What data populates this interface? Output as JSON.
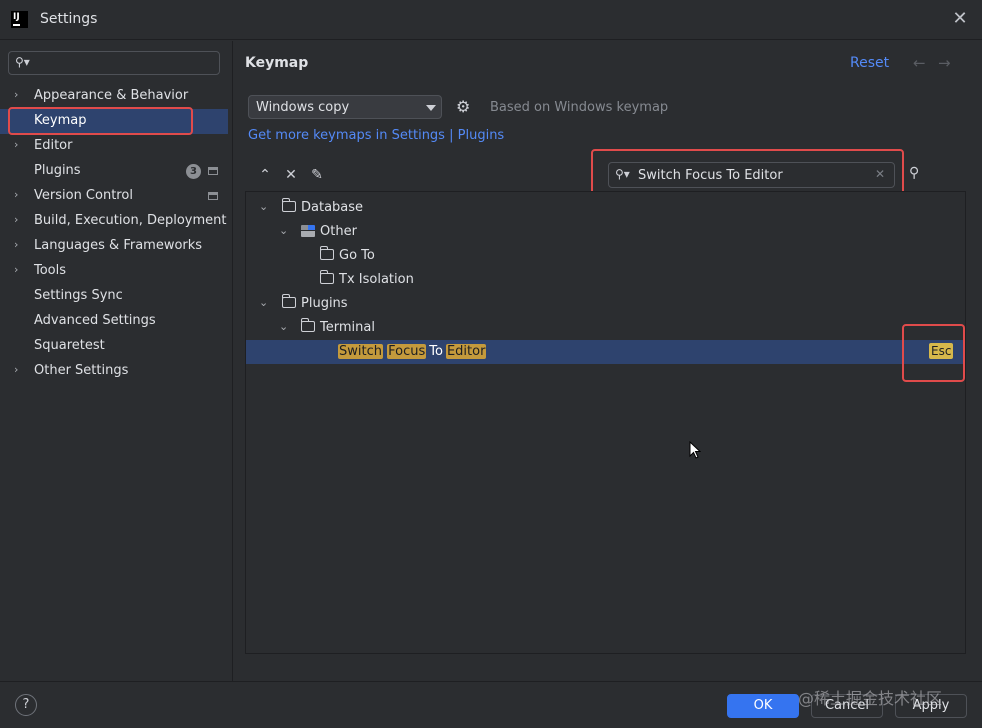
{
  "window": {
    "title": "Settings",
    "app_icon_text": "IJ"
  },
  "sidebar": {
    "search_placeholder": "",
    "items": [
      {
        "label": "Appearance & Behavior",
        "expandable": true
      },
      {
        "label": "Keymap",
        "expandable": false,
        "selected": true
      },
      {
        "label": "Editor",
        "expandable": true
      },
      {
        "label": "Plugins",
        "expandable": false,
        "badge": "3"
      },
      {
        "label": "Version Control",
        "expandable": true
      },
      {
        "label": "Build, Execution, Deployment",
        "expandable": true
      },
      {
        "label": "Languages & Frameworks",
        "expandable": true
      },
      {
        "label": "Tools",
        "expandable": true
      },
      {
        "label": "Settings Sync",
        "expandable": false
      },
      {
        "label": "Advanced Settings",
        "expandable": false
      },
      {
        "label": "Squaretest",
        "expandable": false
      },
      {
        "label": "Other Settings",
        "expandable": true
      }
    ]
  },
  "main": {
    "title": "Keymap",
    "reset_label": "Reset",
    "back_arrow": "←",
    "forward_arrow": "→",
    "keymap_select": "Windows copy",
    "based_on": "Based on Windows keymap",
    "more_keymaps_prefix": "Get more keymaps in Settings",
    "more_keymaps_sep": "|",
    "more_keymaps_link": "Plugins",
    "search_value": "Switch Focus To Editor",
    "tree": [
      {
        "label": "Database",
        "level": 0,
        "icon": "folder",
        "expanded": true
      },
      {
        "label": "Other",
        "level": 1,
        "icon": "other",
        "expanded": true
      },
      {
        "label": "Go To",
        "level": 2,
        "icon": "folder",
        "expanded": false
      },
      {
        "label": "Tx Isolation",
        "level": 2,
        "icon": "folder",
        "expanded": false
      },
      {
        "label": "Plugins",
        "level": 0,
        "icon": "folder",
        "expanded": true
      },
      {
        "label": "Terminal",
        "level": 1,
        "icon": "folder",
        "expanded": true
      }
    ],
    "action": {
      "words": [
        "Switch",
        "Focus",
        "To",
        "Editor"
      ],
      "shortcut": "Esc"
    }
  },
  "footer": {
    "help": "?",
    "ok": "OK",
    "cancel": "Cancel",
    "apply": "Apply",
    "watermark": "@稀土掘金技术社区"
  },
  "colors": {
    "background": "#2b2d30",
    "selection": "#2e436e",
    "accent": "#3574f0",
    "link": "#548af7",
    "match_highlight": "#c49a3c",
    "annotation_box": "#e04b4b"
  }
}
